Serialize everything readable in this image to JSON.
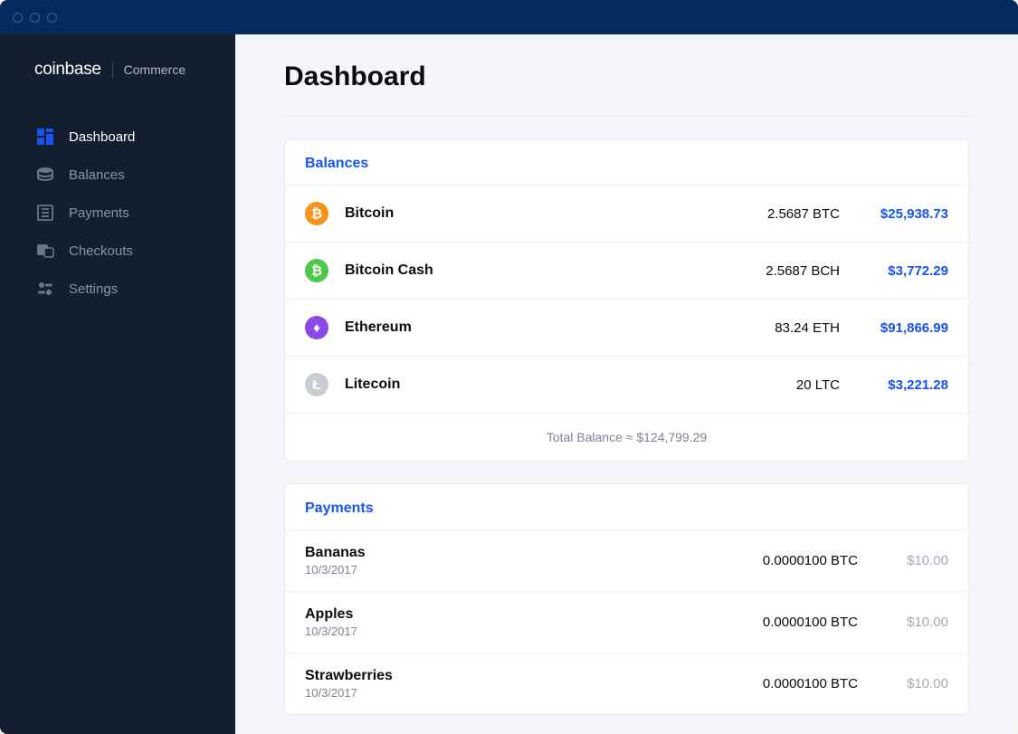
{
  "logo": {
    "main": "coinbase",
    "sub": "Commerce"
  },
  "nav": {
    "dashboard": "Dashboard",
    "balances": "Balances",
    "payments": "Payments",
    "checkouts": "Checkouts",
    "settings": "Settings"
  },
  "page": {
    "title": "Dashboard"
  },
  "balances": {
    "header": "Balances",
    "items": [
      {
        "name": "Bitcoin",
        "qty": "2.5687 BTC",
        "usd": "$25,938.73",
        "color": "#f7931a",
        "glyph": "₿"
      },
      {
        "name": "Bitcoin Cash",
        "qty": "2.5687 BCH",
        "usd": "$3,772.29",
        "color": "#4cca47",
        "glyph": "₿"
      },
      {
        "name": "Ethereum",
        "qty": "83.24 ETH",
        "usd": "$91,866.99",
        "color": "#8b49e6",
        "glyph": "♦"
      },
      {
        "name": "Litecoin",
        "qty": "20 LTC",
        "usd": "$3,221.28",
        "color": "#c9ccd2",
        "glyph": "Ł"
      }
    ],
    "total_label": "Total Balance ≈ $124,799.29"
  },
  "payments": {
    "header": "Payments",
    "items": [
      {
        "name": "Bananas",
        "date": "10/3/2017",
        "amount": "0.0000100 BTC",
        "usd": "$10.00"
      },
      {
        "name": "Apples",
        "date": "10/3/2017",
        "amount": "0.0000100 BTC",
        "usd": "$10.00"
      },
      {
        "name": "Strawberries",
        "date": "10/3/2017",
        "amount": "0.0000100 BTC",
        "usd": "$10.00"
      }
    ]
  }
}
